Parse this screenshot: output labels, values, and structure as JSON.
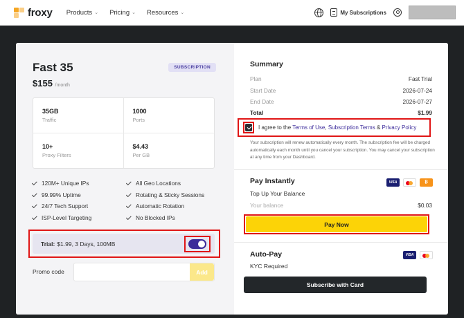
{
  "header": {
    "logo_text": "froxy",
    "nav": [
      {
        "label": "Products"
      },
      {
        "label": "Pricing"
      },
      {
        "label": "Resources"
      }
    ],
    "subscriptions_label": "My Subscriptions"
  },
  "plan": {
    "name": "Fast 35",
    "badge": "SUBSCRIPTION",
    "price": "$155",
    "period": "/month",
    "specs": [
      {
        "value": "35GB",
        "label": "Traffic"
      },
      {
        "value": "1000",
        "label": "Ports"
      },
      {
        "value": "10+",
        "label": "Proxy Filters"
      },
      {
        "value": "$4.43",
        "label": "Per GB"
      }
    ],
    "features": [
      "120M+ Unique IPs",
      "All Geo Locations",
      "99.99% Uptime",
      "Rotating & Sticky Sessions",
      "24/7 Tech Support",
      "Automatic Rotation",
      "ISP-Level Targeting",
      "No Blocked IPs"
    ],
    "trial_label": "Trial:",
    "trial_text": "$1.99, 3 Days, 100MB",
    "trial_enabled": true,
    "promo_label": "Promo code",
    "promo_placeholder": "",
    "add_label": "Add"
  },
  "summary": {
    "title": "Summary",
    "rows": [
      {
        "label": "Plan",
        "value": "Fast Trial"
      },
      {
        "label": "Start Date",
        "value": "2026-07-24"
      },
      {
        "label": "End Date",
        "value": "2026-07-27"
      }
    ],
    "total_label": "Total",
    "total_value": "$1.99",
    "agree_prefix": "I agree to the",
    "terms_of_use": "Terms of Use",
    "comma": ",",
    "subscription_terms": "Subscription Terms",
    "amp": "&",
    "privacy_policy": "Privacy Policy",
    "agree_checked": true,
    "fine_print": "Your subscription will renew automatically every month. The subscription fee will be charged automatically each month until you cancel your subscription. You may cancel your subscription at any time from your Dashboard."
  },
  "pay_instantly": {
    "title": "Pay Instantly",
    "subtitle": "Top Up Your Balance",
    "balance_label": "Your balance",
    "balance_value": "$0.03",
    "button": "Pay Now",
    "card_icons": [
      "visa-icon",
      "mastercard-icon",
      "bitcoin-icon"
    ]
  },
  "auto_pay": {
    "title": "Auto-Pay",
    "subtitle": "KYC Required",
    "button": "Subscribe with Card",
    "card_icons": [
      "visa-icon",
      "mastercard-icon"
    ]
  },
  "colors": {
    "accent": "#3b2a9a",
    "pay_yellow": "#fcd307",
    "highlight_red": "#e01515",
    "logo_orange": "#f5a623"
  }
}
